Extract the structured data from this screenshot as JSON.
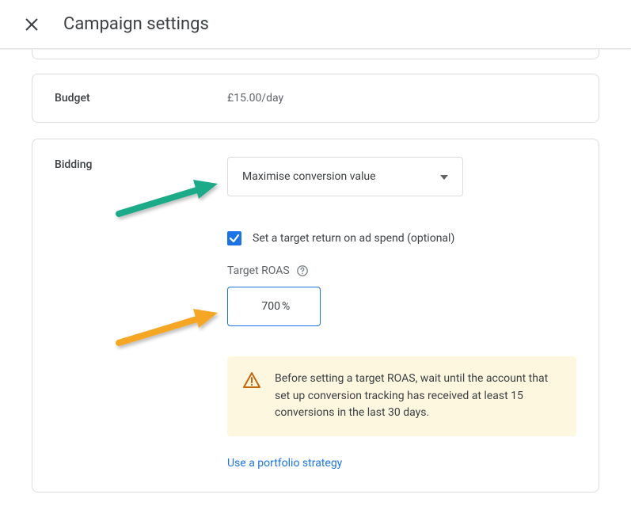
{
  "header": {
    "title": "Campaign settings"
  },
  "budget": {
    "label": "Budget",
    "value": "£15.00/day"
  },
  "bidding": {
    "label": "Bidding",
    "strategy_dropdown": "Maximise conversion value",
    "checkbox_label": "Set a target return on ad spend (optional)",
    "checkbox_checked": true,
    "target_roas_label": "Target ROAS",
    "target_roas_value": "700",
    "target_roas_suffix": "%",
    "warning_text": "Before setting a target ROAS, wait until the account that set up conversion tracking has received at least 15 conversions in the last 30 days.",
    "portfolio_link": "Use a portfolio strategy"
  }
}
